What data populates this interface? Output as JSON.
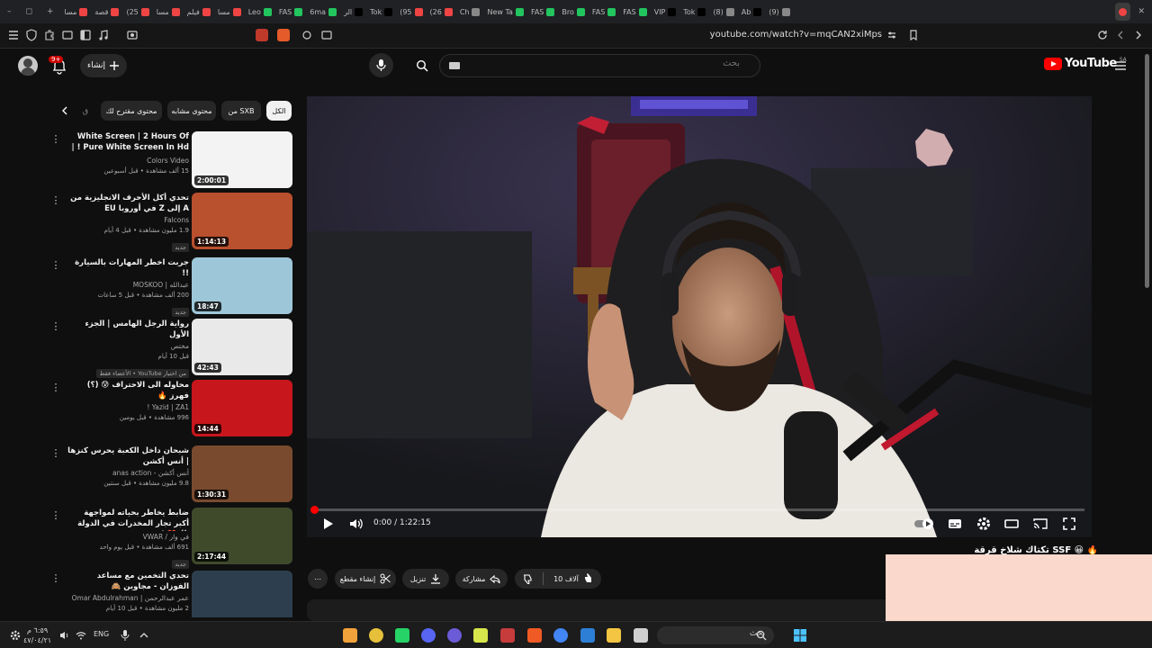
{
  "browser": {
    "tabs": [
      {
        "label": "(9)",
        "color": "#888888"
      },
      {
        "label": "Ab",
        "color": "#000000"
      },
      {
        "label": "(8)",
        "color": "#888888"
      },
      {
        "label": "Tok",
        "color": "#000000"
      },
      {
        "label": "VIP",
        "color": "#000000"
      },
      {
        "label": "FAS",
        "color": "#22c55e"
      },
      {
        "label": "FAS",
        "color": "#22c55e"
      },
      {
        "label": "Bro",
        "color": "#22c55e"
      },
      {
        "label": "FAS",
        "color": "#22c55e"
      },
      {
        "label": "New Ta",
        "color": "#22c55e"
      },
      {
        "label": "Ch",
        "color": "#888888"
      },
      {
        "label": "(26",
        "color": "#ef4444"
      },
      {
        "label": "(95",
        "color": "#ef4444"
      },
      {
        "label": "Tok",
        "color": "#000000"
      },
      {
        "label": "الر",
        "color": "#000000"
      },
      {
        "label": "6ma",
        "color": "#22c55e"
      },
      {
        "label": "FAS",
        "color": "#22c55e"
      },
      {
        "label": "Leo",
        "color": "#22c55e"
      },
      {
        "label": "مسا",
        "color": "#ef4444"
      },
      {
        "label": "فيلم",
        "color": "#ef4444"
      },
      {
        "label": "مسا",
        "color": "#ef4444"
      },
      {
        "label": "(25",
        "color": "#ef4444"
      },
      {
        "label": "قصة",
        "color": "#ef4444"
      },
      {
        "label": "مسا",
        "color": "#ef4444"
      }
    ],
    "url": "youtube.com/watch?v=mqCAN2xiMps"
  },
  "header": {
    "create_label": "إنشاء",
    "notif_count": "9+",
    "search_placeholder": "بحث",
    "logo_text": "YouTube",
    "country": "SA"
  },
  "chips": [
    "الكل",
    "من SXB",
    "محتوى مشابه",
    "محتوى مقترح لك",
    "ق"
  ],
  "recommendations": [
    {
      "title": "White Screen | 2 Hours Of Pure White Screen In Hd ! | ...",
      "channel": "Colors Video",
      "meta": "15 ألف مشاهدة • قبل أسبوعين",
      "badge": "",
      "duration": "2:00:01",
      "thumb": "#f3f3f3"
    },
    {
      "title": "تحدي أكل الأحرف الانجليزية من A إلى Z في أوروبا EU",
      "channel": "Falcons",
      "meta": "1.9 مليون مشاهدة • قبل 4 أيام",
      "badge": "جديد",
      "duration": "1:14:13",
      "thumb": "#b9502e"
    },
    {
      "title": "جربت اخطر المهارات بالسيارة !!",
      "channel": "عبدالله | MOSKOO",
      "meta": "200 ألف مشاهدة • قبل 5 ساعات",
      "badge": "جديد",
      "duration": "18:47",
      "thumb": "#9dc7d8"
    },
    {
      "title": "رواية الرجل الهامس | الجزء الأول",
      "channel": "مختص",
      "meta": "قبل 10 أيام",
      "badge": "من اختيار YouTube • الأعضاء فقط",
      "duration": "42:43",
      "thumb": "#e9e9e9"
    },
    {
      "title": "محاوله الى الاحتراف 😰 (؟) فهرز 🔥",
      "channel": "Yazid | ZA1 !",
      "meta": "996 مشاهدة • قبل يومين",
      "badge": "",
      "duration": "14:44",
      "thumb": "#c8161d"
    },
    {
      "title": "شبحان داخل الكعبة يحرس كنزها | أنس أكشن",
      "channel": "أنس أكشن - anas action",
      "meta": "9.8 مليون مشاهدة • قبل سنتين",
      "badge": "",
      "duration": "1:30:31",
      "thumb": "#7a4a2e"
    },
    {
      "title": "ضابط يخاطر بحياته لمواجهة أكبر تجار المخدرات في الدولة 🐰 💔 !",
      "channel": "في وار / VWAR",
      "meta": "691 ألف مشاهدة • قبل يوم واحد",
      "badge": "جديد",
      "duration": "2:17:44",
      "thumb": "#3f4a2b"
    },
    {
      "title": "تحدي التخمين مع مساعد الفوزان - مجاوين 🙈",
      "channel": "عمر عبدالرحمن | Omar Abdulrahman",
      "meta": "2 مليون مشاهدة • قبل 10 أيام",
      "badge": "",
      "duration": "",
      "thumb": "#2d3f4f"
    }
  ],
  "player": {
    "current_time": "0:00",
    "total_time": "1:22:15",
    "progress": 0.0
  },
  "video": {
    "title": "تكتاك شلاخ قرقة SSF 😀 🔥",
    "likes": "10 آلاف",
    "share_label": "مشاركة",
    "download_label": "تنزيل",
    "clip_label": "إنشاء مقطع"
  },
  "taskbar": {
    "search_placeholder": "بحث",
    "language": "ENG",
    "time": "٦:٥٩ م",
    "date": "٤٧/٠٤/٢١"
  }
}
